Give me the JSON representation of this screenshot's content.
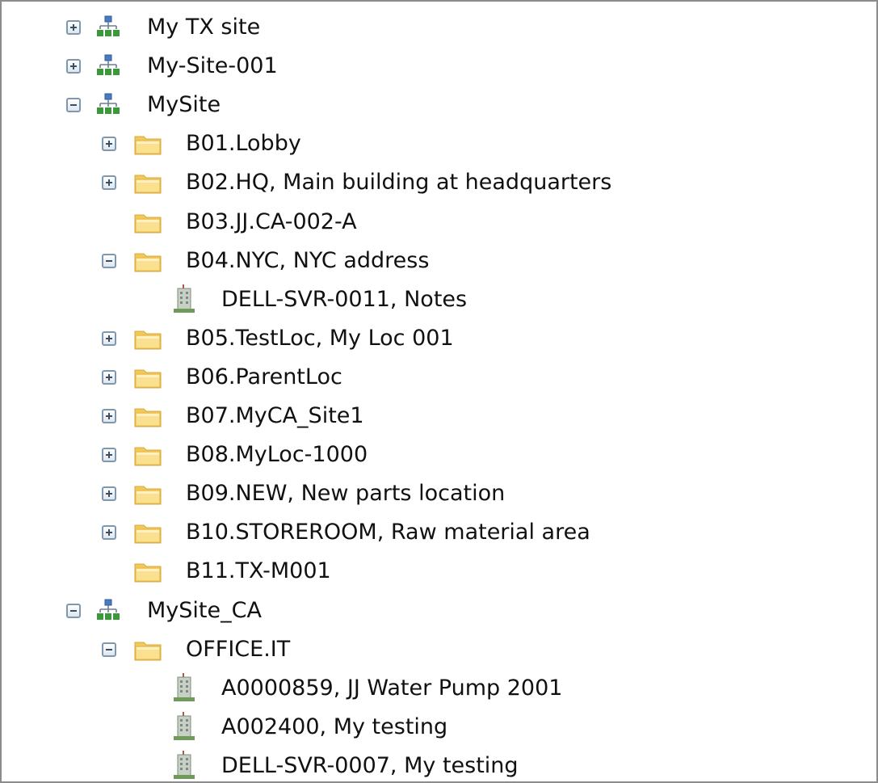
{
  "tree": {
    "nodes": [
      {
        "level": 0,
        "type": "site",
        "state": "collapsed",
        "label": "My TX site"
      },
      {
        "level": 0,
        "type": "site",
        "state": "collapsed",
        "label": "My-Site-001"
      },
      {
        "level": 0,
        "type": "site",
        "state": "expanded",
        "label": "MySite"
      },
      {
        "level": 1,
        "type": "folder",
        "state": "collapsed",
        "label": "B01.Lobby"
      },
      {
        "level": 1,
        "type": "folder",
        "state": "collapsed",
        "label": "B02.HQ, Main building at headquarters"
      },
      {
        "level": 1,
        "type": "folder",
        "state": "leaf",
        "label": "B03.JJ.CA-002-A"
      },
      {
        "level": 1,
        "type": "folder",
        "state": "expanded",
        "label": "B04.NYC, NYC address"
      },
      {
        "level": 2,
        "type": "asset",
        "state": "leaf",
        "label": "DELL-SVR-0011, Notes"
      },
      {
        "level": 1,
        "type": "folder",
        "state": "collapsed",
        "label": "B05.TestLoc, My Loc 001"
      },
      {
        "level": 1,
        "type": "folder",
        "state": "collapsed",
        "label": "B06.ParentLoc"
      },
      {
        "level": 1,
        "type": "folder",
        "state": "collapsed",
        "label": "B07.MyCA_Site1"
      },
      {
        "level": 1,
        "type": "folder",
        "state": "collapsed",
        "label": "B08.MyLoc-1000"
      },
      {
        "level": 1,
        "type": "folder",
        "state": "collapsed",
        "label": "B09.NEW, New parts location"
      },
      {
        "level": 1,
        "type": "folder",
        "state": "collapsed",
        "label": "B10.STOREROOM, Raw material area"
      },
      {
        "level": 1,
        "type": "folder",
        "state": "leaf",
        "label": "B11.TX-M001"
      },
      {
        "level": 0,
        "type": "site",
        "state": "expanded",
        "label": "MySite_CA"
      },
      {
        "level": 1,
        "type": "folder",
        "state": "expanded",
        "label": "OFFICE.IT"
      },
      {
        "level": 2,
        "type": "asset",
        "state": "leaf",
        "label": "A0000859, JJ Water Pump 2001"
      },
      {
        "level": 2,
        "type": "asset",
        "state": "leaf",
        "label": "A002400, My testing"
      },
      {
        "level": 2,
        "type": "asset",
        "state": "leaf",
        "label": "DELL-SVR-0007, My testing"
      }
    ]
  },
  "icons": {
    "site": "site-hierarchy-icon",
    "folder": "folder-icon",
    "asset": "building-asset-icon",
    "expanded": "collapse-minus-icon",
    "collapsed": "expand-plus-icon"
  },
  "colors": {
    "folder_fill": "#f9d877",
    "site_blue": "#4a7bc0",
    "site_green": "#3a9a3a",
    "asset_green": "#6f9a5a",
    "border": "#8c8c8c"
  }
}
